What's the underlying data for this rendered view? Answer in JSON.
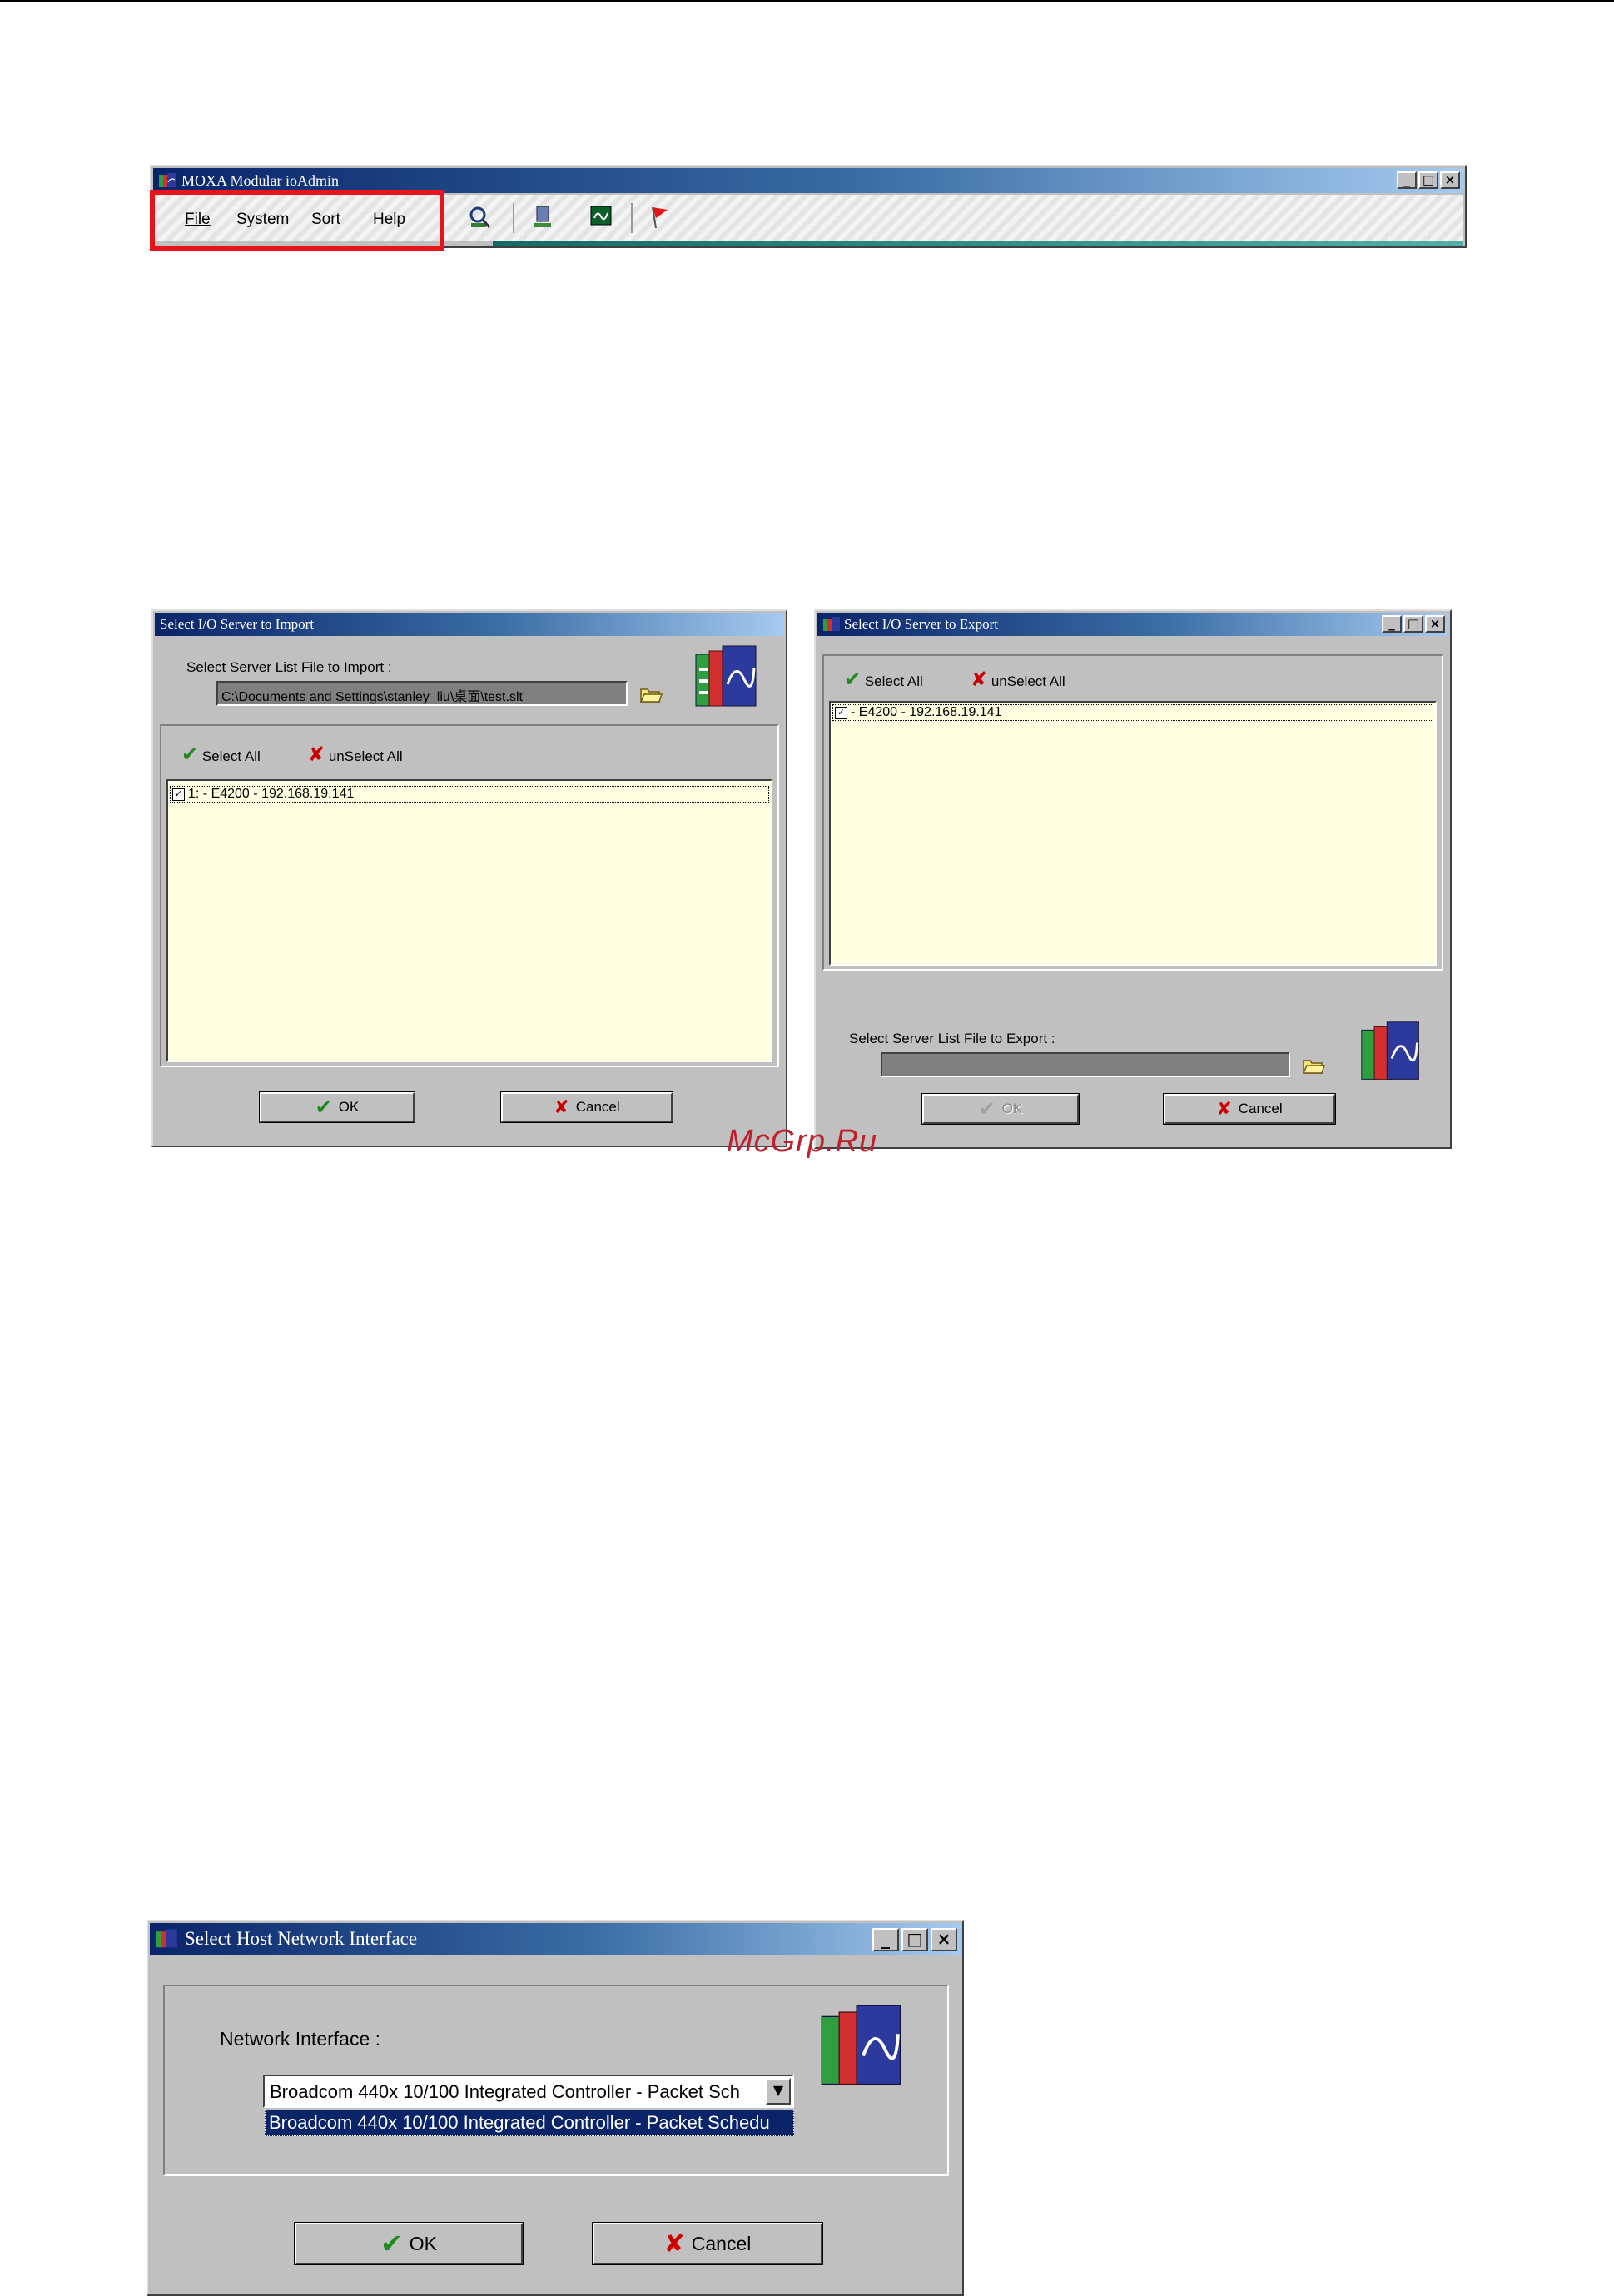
{
  "main_window": {
    "title": "MOXA Modular ioAdmin",
    "menu": [
      {
        "label": "File"
      },
      {
        "label": "System"
      },
      {
        "label": "Sort"
      },
      {
        "label": "Help"
      }
    ],
    "toolbar_icons": [
      "search-network-icon",
      "server-icon",
      "monitor-icon",
      "flag-icon"
    ],
    "highlight_color": "#e8141c"
  },
  "import_dialog": {
    "title": "Select I/O Server to Import",
    "file_label": "Select Server List File to Import :",
    "file_path": "C:\\Documents and Settings\\stanley_liu\\桌面\\test.slt",
    "select_all": "Select All",
    "unselect_all": "unSelect All",
    "items": [
      {
        "label": "1: - E4200 - 192.168.19.141",
        "checked": true
      }
    ],
    "ok": "OK",
    "cancel": "Cancel"
  },
  "export_dialog": {
    "title": "Select I/O Server to Export",
    "select_all": "Select All",
    "unselect_all": "unSelect All",
    "items": [
      {
        "label": "- E4200 - 192.168.19.141",
        "checked": true
      }
    ],
    "file_label": "Select Server List File to Export :",
    "file_path": "",
    "ok": "OK",
    "cancel": "Cancel"
  },
  "watermark": "McGrp.Ru",
  "host_dialog": {
    "title": "Select Host Network Interface",
    "label": "Network Interface :",
    "selected": "Broadcom 440x 10/100 Integrated Controller - Packet Sch",
    "option": "Broadcom 440x 10/100 Integrated Controller - Packet Schedu",
    "ok": "OK",
    "cancel": "Cancel"
  }
}
